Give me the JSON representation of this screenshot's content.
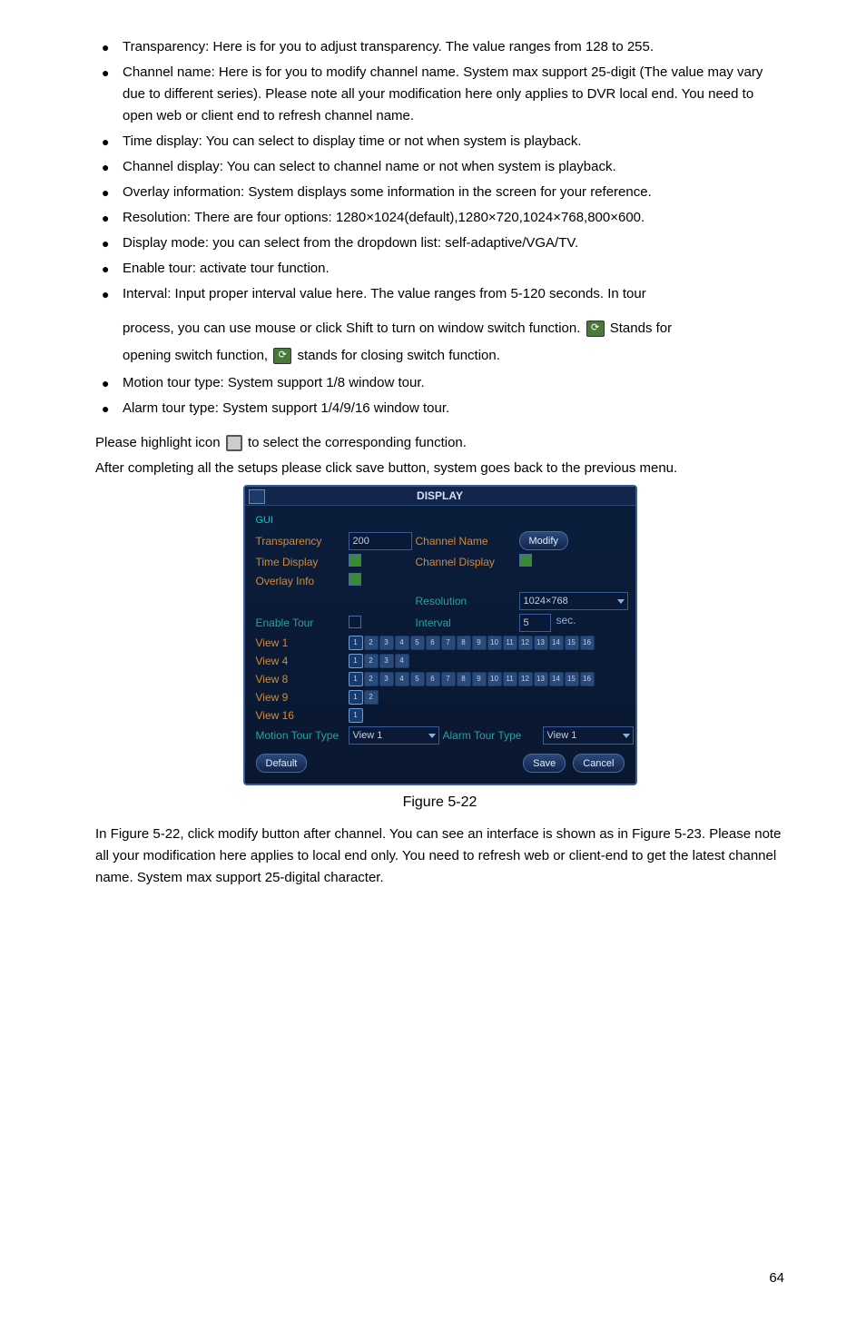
{
  "bullets": {
    "transparency": "Transparency: Here is for you to adjust transparency. The value ranges from 128 to 255.",
    "channel_name": "Channel name: Here is for you to modify channel name. System max support 25-digit (The value may vary due to different series). Please note all your modification here only applies to DVR local end. You need to open web or client end to refresh channel name.",
    "time_display": "Time display: You can select to display time or not when system is playback.",
    "channel_display": "Channel display: You can select to channel name or not when system is playback.",
    "overlay": "Overlay information: System displays some information in the screen for your reference.",
    "resolution": "Resolution: There are four options: 1280×1024(default),1280×720,1024×768,800×600.",
    "display_mode": "Display mode: you can select from the dropdown list: self-adaptive/VGA/TV.",
    "enable_tour": "Enable tour: activate tour function.",
    "interval_first": "Interval: Input proper interval value here. The value ranges from 5-120 seconds. In tour",
    "interval_cont1a": "process, you can use mouse or click Shift to turn on window switch function. ",
    "interval_cont1b": " Stands for",
    "interval_cont2a": "opening switch function, ",
    "interval_cont2b": " stands for closing switch function.",
    "motion_tour": "Motion tour type: System support 1/8 window tour.",
    "alarm_tour": "Alarm tour type: System support 1/4/9/16 window tour."
  },
  "pre_figure": {
    "line1a": "Please highlight icon ",
    "line1b": " to select the corresponding function.",
    "line2": "After completing all the setups please click save button, system goes back to the previous menu."
  },
  "window": {
    "title": "DISPLAY",
    "gui": "GUI",
    "rows": {
      "transparency": "Transparency",
      "transparency_val": "200",
      "channel_name": "Channel Name",
      "modify": "Modify",
      "time_display": "Time Display",
      "channel_display": "Channel Display",
      "overlay_info": "Overlay Info",
      "resolution": "Resolution",
      "resolution_val": "1024×768",
      "enable_tour": "Enable Tour",
      "interval": "Interval",
      "interval_val": "5",
      "interval_unit": "sec.",
      "view1": "View 1",
      "view4": "View 4",
      "view8": "View 8",
      "view9": "View 9",
      "view16": "View 16",
      "motion_tour": "Motion Tour Type",
      "motion_tour_val": "View 1",
      "alarm_tour": "Alarm Tour Type",
      "alarm_tour_val": "View 1"
    },
    "buttons": {
      "default": "Default",
      "save": "Save",
      "cancel": "Cancel"
    }
  },
  "figure_label": "Figure 5-22",
  "post_paragraph": "In Figure 5-22, click modify button after channel. You can see an interface is shown as in Figure 5-23. Please note all your modification here applies to local end only. You need to refresh web or client-end to get the latest channel name. System max support 25-digital character.",
  "page_number": "64"
}
